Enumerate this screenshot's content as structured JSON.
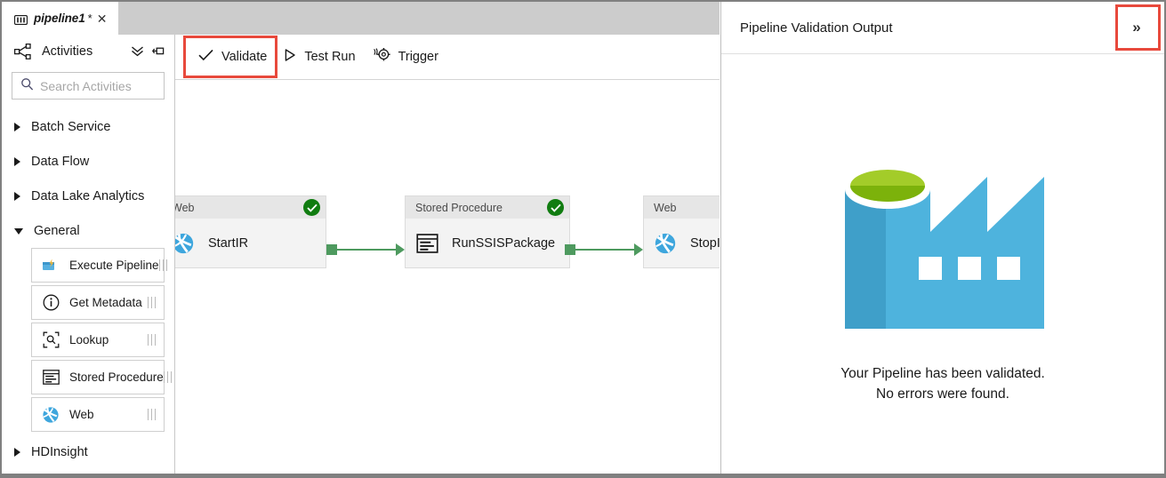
{
  "window": {
    "tab": {
      "icon": "pipeline-icon",
      "title": "pipeline1",
      "dirty_marker": "*",
      "close_glyph": "✕"
    }
  },
  "sidebar": {
    "header": {
      "icon": "activities-hierarchy-icon",
      "label": "Activities",
      "collapse_all_icon": "chevron-double-down-icon",
      "pin_icon": "pin-icon"
    },
    "search": {
      "icon": "search-icon",
      "placeholder": "Search Activities",
      "value": ""
    },
    "tree": [
      {
        "label": "Batch Service",
        "expanded": false
      },
      {
        "label": "Data Flow",
        "expanded": false
      },
      {
        "label": "Data Lake Analytics",
        "expanded": false
      },
      {
        "label": "General",
        "expanded": true
      },
      {
        "label": "HDInsight",
        "expanded": false
      }
    ],
    "general_activities": [
      {
        "label": "Execute Pipeline",
        "icon": "execute-pipeline-icon"
      },
      {
        "label": "Get Metadata",
        "icon": "info-circle-icon"
      },
      {
        "label": "Lookup",
        "icon": "lookup-icon"
      },
      {
        "label": "Stored Procedure",
        "icon": "stored-procedure-icon"
      },
      {
        "label": "Web",
        "icon": "web-globe-icon"
      }
    ]
  },
  "toolbar": {
    "validate": {
      "label": "Validate",
      "icon": "checkmark-icon",
      "highlighted": true
    },
    "test_run": {
      "label": "Test Run",
      "icon": "play-icon",
      "highlighted": false
    },
    "trigger": {
      "label": "Trigger",
      "icon": "trigger-gear-icon",
      "highlighted": false
    }
  },
  "canvas": {
    "nodes": [
      {
        "type": "Web",
        "name": "StartIR",
        "icon": "web-globe-icon",
        "status": "success",
        "status_glyph": "✓"
      },
      {
        "type": "Stored Procedure",
        "name": "RunSSISPackage",
        "icon": "stored-procedure-icon",
        "status": "success",
        "status_glyph": "✓"
      },
      {
        "type": "Web",
        "name": "StopIR",
        "icon": "web-globe-icon",
        "status": "none",
        "status_glyph": ""
      }
    ],
    "connectors": [
      {
        "from": "StartIR",
        "to": "RunSSISPackage",
        "color": "#4e9a5f"
      },
      {
        "from": "RunSSISPackage",
        "to": "StopIR",
        "color": "#4e9a5f"
      }
    ]
  },
  "right_panel": {
    "title": "Pipeline Validation Output",
    "collapse_button": {
      "glyph": "»",
      "name": "collapse-panel-button",
      "highlighted": true
    },
    "logo": "azure-data-factory-logo",
    "message_line1": "Your Pipeline has been validated.",
    "message_line2": "No errors were found."
  },
  "colors": {
    "highlight_red": "#e8493c",
    "success_green": "#107c10",
    "connector_green": "#4e9a5f",
    "factory_blue": "#4eb3dd",
    "factory_blue_dark": "#3f9fc9",
    "factory_green": "#a3cc29",
    "tabstrip_gray": "#cccccc"
  }
}
